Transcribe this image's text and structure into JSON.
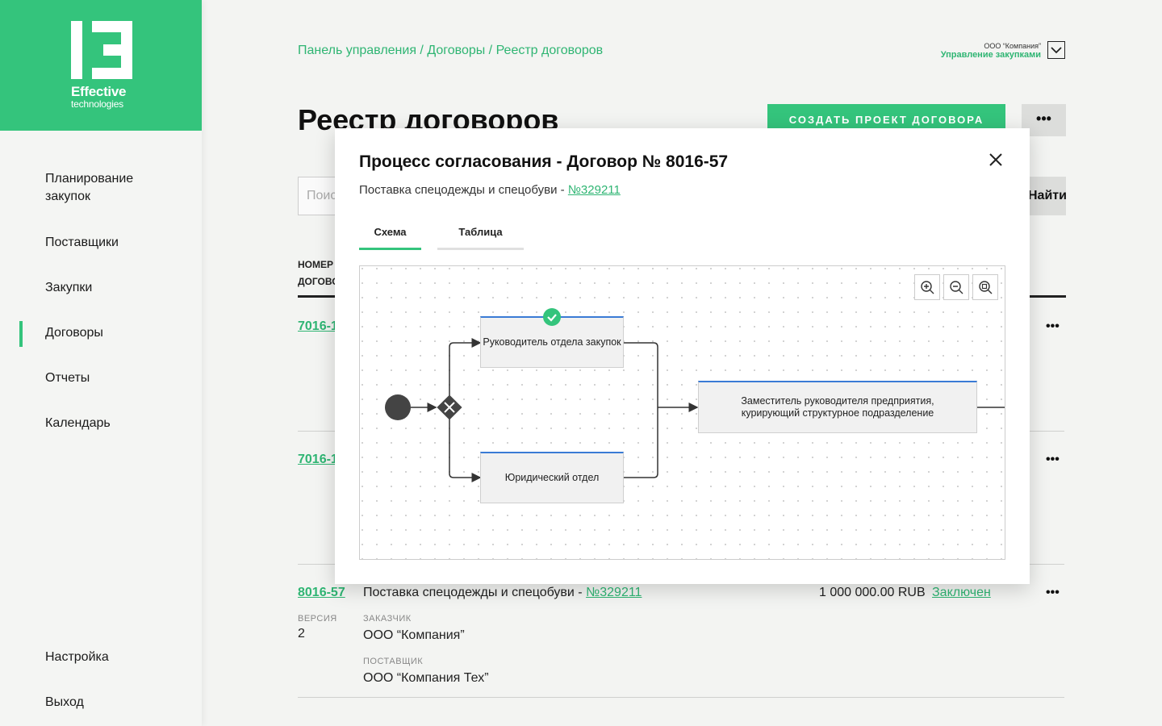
{
  "logo": {
    "name": "Effective",
    "sub": "technologies"
  },
  "nav": {
    "items": [
      {
        "label_l1": "Планирование",
        "label_l2": "закупок"
      },
      {
        "label": "Поставщики"
      },
      {
        "label": "Закупки"
      },
      {
        "label": "Договоры"
      },
      {
        "label": "Отчеты"
      },
      {
        "label": "Календарь"
      }
    ],
    "settings": "Настройка",
    "logout": "Выход"
  },
  "breadcrumb": "Панель управления / Договоры / Реестр договоров",
  "company": {
    "name": "ООО “Компания”",
    "role": "Управление закупками"
  },
  "page": {
    "title": "Реестр договоров",
    "create_label": "СОЗДАТЬ ПРОЕКТ ДОГОВОРА",
    "more_label": "•••",
    "search_placeholder": "Поиск",
    "find_label": "Найти"
  },
  "table": {
    "col_number_l1": "НОМЕР",
    "col_number_l2": "ДОГОВОРА",
    "rows": [
      {
        "number": "7016-1"
      },
      {
        "number": "7016-1"
      },
      {
        "number": "8016-57",
        "title": "Поставка спецодежды и спецобуви - ",
        "title_link": "№329211",
        "amount": "1 000 000.00 RUB",
        "status": "Заключен",
        "version_label": "ВЕРСИЯ",
        "version": "2",
        "customer_label": "ЗАКАЗЧИК",
        "customer": "ООО “Компания”",
        "supplier_label": "ПОСТАВЩИК",
        "supplier": "ООО “Компания Тех”"
      }
    ],
    "row_more": "•••"
  },
  "modal": {
    "title": "Процесс согласования - Договор № 8016-57",
    "subtitle": "Поставка спецодежды и спецобуви - ",
    "subtitle_link": "№329211",
    "close": "✕",
    "tabs": [
      {
        "label": "Схема",
        "active": true
      },
      {
        "label": "Таблица",
        "active": false
      }
    ],
    "diagram": {
      "nodes": [
        {
          "label": "Руководитель отдела закупок",
          "done": true
        },
        {
          "label": "Юридический отдел",
          "done": false
        },
        {
          "label": "Заместитель руководителя предприятия, курирующий структурное подразделение",
          "done": false
        }
      ],
      "zoom_icons": [
        "zoom-in-icon",
        "zoom-out-icon",
        "zoom-reset-icon"
      ]
    }
  },
  "colors": {
    "accent": "#34c47c",
    "link": "#2fb573",
    "node_top": "#3a7bd5"
  }
}
